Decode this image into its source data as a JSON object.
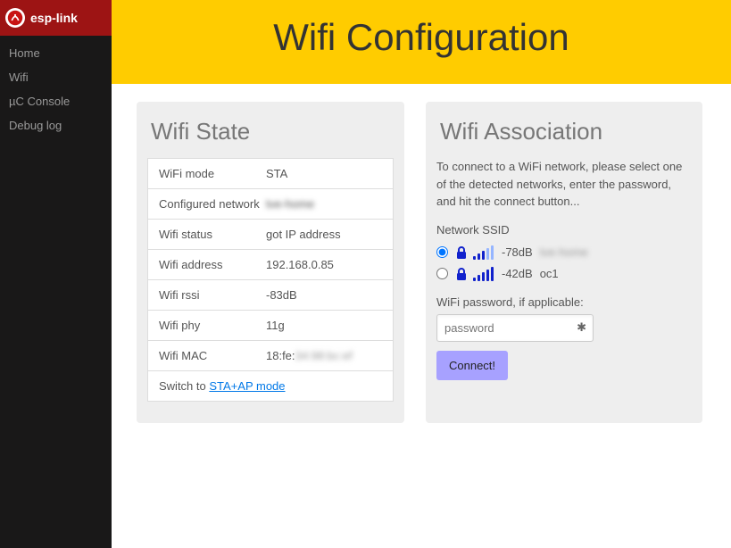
{
  "brand": "esp-link",
  "nav": {
    "home": "Home",
    "wifi": "Wifi",
    "console": "µC Console",
    "debug": "Debug log"
  },
  "page_title": "Wifi Configuration",
  "wifi_state": {
    "title": "Wifi State",
    "mode_label": "WiFi mode",
    "mode_value": "STA",
    "confnet_label": "Configured network",
    "confnet_value": "tve-home",
    "status_label": "Wifi status",
    "status_value": "got IP address",
    "addr_label": "Wifi address",
    "addr_value": "192.168.0.85",
    "rssi_label": "Wifi rssi",
    "rssi_value": "-83dB",
    "phy_label": "Wifi phy",
    "phy_value": "11g",
    "mac_label": "Wifi MAC",
    "mac_prefix": "18:fe:",
    "mac_rest": "34:98:bc:ef",
    "switch_prefix": "Switch to ",
    "switch_link": "STA+AP mode"
  },
  "wifi_assoc": {
    "title": "Wifi Association",
    "intro": "To connect to a WiFi network, please select one of the detected networks, enter the password, and hit the connect button...",
    "ssid_label": "Network SSID",
    "networks": [
      {
        "rssi": "-78dB",
        "name": "tve-home",
        "selected": true,
        "bars": 3,
        "blur": true
      },
      {
        "rssi": "-42dB",
        "name": "oc1",
        "selected": false,
        "bars": 5,
        "blur": false
      }
    ],
    "pw_label": "WiFi password, if applicable:",
    "pw_placeholder": "password",
    "connect_label": "Connect!"
  }
}
